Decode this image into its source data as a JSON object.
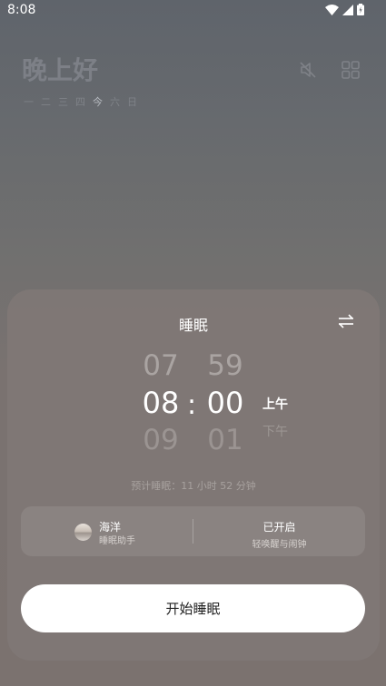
{
  "status_bar": {
    "time": "8:08"
  },
  "header": {
    "greeting": "晚上好",
    "days": [
      "一",
      "二",
      "三",
      "四",
      "今",
      "六",
      "日"
    ],
    "today_index": 4
  },
  "sheet": {
    "title": "睡眠",
    "hours": {
      "above": "07",
      "selected": "08",
      "below": "09"
    },
    "minutes": {
      "above": "59",
      "selected": "00",
      "below": "01"
    },
    "colon": ":",
    "period": {
      "selected": "上午",
      "other": "下午"
    },
    "estimate": "预计睡眠：11 小时 52 分钟",
    "sound": {
      "title": "海洋",
      "subtitle": "睡眠助手"
    },
    "alarm": {
      "title": "已开启",
      "subtitle": "轻唤醒与闹钟"
    },
    "start_label": "开始睡眠"
  }
}
